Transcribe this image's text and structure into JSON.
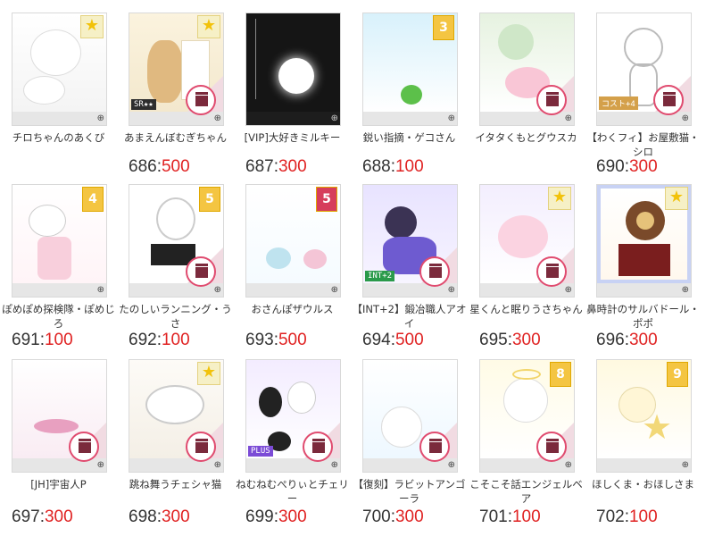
{
  "items": [
    {
      "name": "チロちゃんのあくび",
      "number": "",
      "price": "",
      "badge": "star",
      "tag": ""
    },
    {
      "name": "あまえんぼむぎちゃん",
      "number": "686:",
      "price": "500",
      "badge": "star",
      "tag": "SR★★"
    },
    {
      "name": "[VIP]大好きミルキー",
      "number": "687:",
      "price": "300",
      "badge": "",
      "tag": ""
    },
    {
      "name": "鋭い指摘・ゲコさん",
      "number": "688:",
      "price": "100",
      "badge": "3",
      "tag": ""
    },
    {
      "name": "イタタくもとグウスカ",
      "number": "",
      "price": "",
      "badge": "",
      "tag": ""
    },
    {
      "name": "【わくフィ】お屋敷猫・シロ",
      "number": "690:",
      "price": "300",
      "badge": "",
      "tag": "コスト+4"
    },
    {
      "name": "ぽめぽめ探検隊・ぽめじろ",
      "number": "691:",
      "price": "100",
      "badge": "4",
      "tag": ""
    },
    {
      "name": "たのしいランニング・うさ",
      "number": "692:",
      "price": "100",
      "badge": "5",
      "tag": ""
    },
    {
      "name": "おさんぽザウルス",
      "number": "693:",
      "price": "500",
      "badge": "5",
      "tag": ""
    },
    {
      "name": "【INT+2】鍛冶職人アオイ",
      "number": "694:",
      "price": "500",
      "badge": "",
      "tag": "INT+2"
    },
    {
      "name": "星くんと眠りうさちゃん",
      "number": "695:",
      "price": "300",
      "badge": "star",
      "tag": ""
    },
    {
      "name": "鼻時計のサルバドール・ポポ",
      "number": "696:",
      "price": "300",
      "badge": "star",
      "tag": ""
    },
    {
      "name": "[JH]宇宙人P",
      "number": "697:",
      "price": "300",
      "badge": "",
      "tag": ""
    },
    {
      "name": "跳ね舞うチェシャ猫",
      "number": "698:",
      "price": "300",
      "badge": "star",
      "tag": ""
    },
    {
      "name": "ねむねむぺりぃとチェリー",
      "number": "699:",
      "price": "300",
      "badge": "",
      "tag": "PLUS"
    },
    {
      "name": "【復刻】ラビットアンゴーラ",
      "number": "700:",
      "price": "300",
      "badge": "",
      "tag": ""
    },
    {
      "name": "こそこそ話エンジェルベア",
      "number": "701:",
      "price": "100",
      "badge": "8",
      "tag": ""
    },
    {
      "name": "ほしくま・おほしさま",
      "number": "702:",
      "price": "100",
      "badge": "9",
      "tag": ""
    }
  ],
  "icons": {
    "gift": "gift-icon",
    "zoom": "zoom-icon",
    "star": "star-badge-icon"
  },
  "colors": {
    "price": "#e02222",
    "text": "#333333",
    "gift_border": "#e04b6f"
  }
}
